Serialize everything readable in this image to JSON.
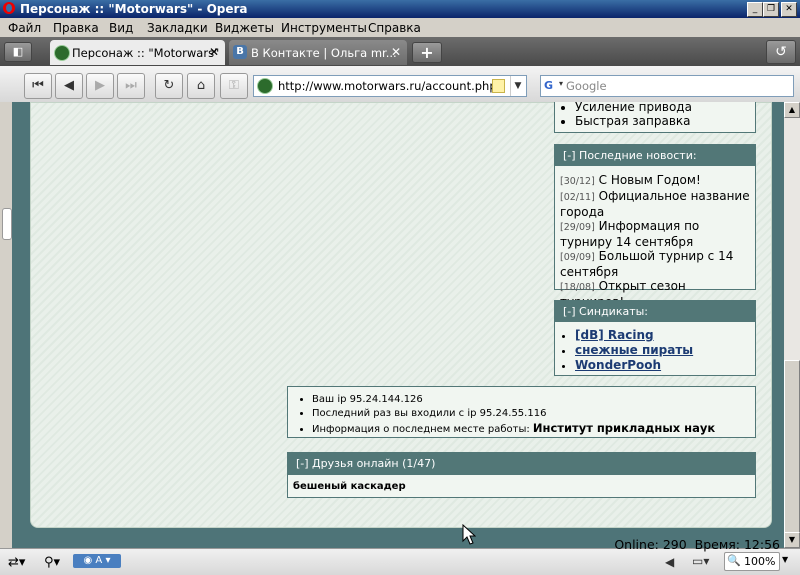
{
  "window": {
    "title": "Персонаж :: \"Motorwars\" - Opera"
  },
  "menu": [
    "Файл",
    "Правка",
    "Вид",
    "Закладки",
    "Виджеты",
    "Инструменты",
    "Справка"
  ],
  "tabs": [
    {
      "label": "Персонаж :: \"Motorwars\"",
      "active": true
    },
    {
      "label": "В Контакте | Ольга mr...",
      "active": false
    }
  ],
  "nav": {
    "url": "http://www.motorwars.ru/account.php",
    "search_placeholder": "Google"
  },
  "top_list": [
    "Усиление привода",
    "Быстрая заправка"
  ],
  "news": {
    "header": "[-]  Последние новости:",
    "items": [
      {
        "date": "[30/12]",
        "text": "С Новым Годом!"
      },
      {
        "date": "[02/11]",
        "text": "Официальное название города"
      },
      {
        "date": "[29/09]",
        "text": "Информация по турниру 14 сентября"
      },
      {
        "date": "[09/09]",
        "text": "Большой турнир с 14 сентября"
      },
      {
        "date": "[18/08]",
        "text": "Открыт сезон турниров!"
      }
    ]
  },
  "syndicates": {
    "header": "[-]  Синдикаты:",
    "items": [
      "[dB] Racing",
      "снежные пираты",
      "WonderPooh"
    ]
  },
  "info": {
    "ip": "Ваш ip 95.24.144.126",
    "last_login": "Последний раз вы входили с ip 95.24.55.116",
    "work_prefix": "Информация о последнем месте работы: ",
    "work_place": "Институт прикладных наук"
  },
  "friends": {
    "header": "[-]  Друзья онлайн (1/47)",
    "items": [
      "бешеный каскадер"
    ]
  },
  "status": {
    "online": "Online: 290",
    "time": "Время: 12:56",
    "zoom": "100%"
  }
}
